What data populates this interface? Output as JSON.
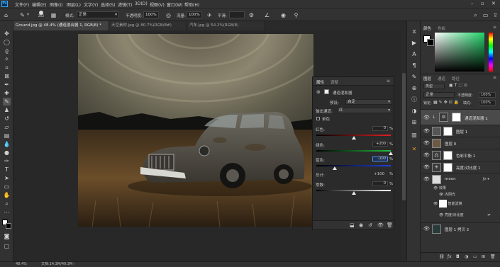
{
  "app": {
    "logo": "Ps"
  },
  "menu": [
    "文件(F)",
    "编辑(E)",
    "图像(I)",
    "图层(L)",
    "文字(Y)",
    "选择(S)",
    "滤镜(T)",
    "3D(D)",
    "视图(V)",
    "窗口(W)",
    "帮助(H)"
  ],
  "options": {
    "brush_size": "202",
    "mode_label": "模式:",
    "mode_value": "正常",
    "opacity_label": "不透明度:",
    "opacity_value": "100%",
    "flow_label": "流量:",
    "flow_value": "100%",
    "smooth_label": "平滑:"
  },
  "tabs": [
    {
      "label": "Ground.jpg @ 48.4% (通道混合器 1, RGB/8) *",
      "active": true
    },
    {
      "label": "天空素材.jpg @ 80.7%(RGB/8#)",
      "active": false
    },
    {
      "label": "汽车.jpg @ 54.2%(RGB/8)",
      "active": false
    }
  ],
  "properties": {
    "tab1": "属性",
    "tab2": "调整",
    "adj_name": "通道混和器",
    "preset_label": "预设:",
    "preset_value": "自定",
    "output_label": "输出通道:",
    "output_value": "红",
    "mono_label": "单色",
    "red_label": "红色:",
    "red_value": "0",
    "red_pct": "%",
    "red_level": 0.5,
    "green_label": "绿色:",
    "green_value": "+200",
    "green_pct": "%",
    "green_level": 1.0,
    "blue_label": "蓝色:",
    "blue_value": "-100",
    "blue_pct": "%",
    "blue_level": 0.25,
    "total_label": "总计:",
    "total_value": "+100",
    "total_pct": "%",
    "const_label": "常数:",
    "const_value": "0",
    "const_pct": "%",
    "const_level": 0.5
  },
  "color_panel": {
    "tab1": "颜色",
    "tab2": "色板"
  },
  "layers_panel": {
    "tabs": [
      "图层",
      "通道",
      "路径"
    ],
    "kind": "类型",
    "blend": "正常",
    "opacity_label": "不透明度:",
    "opacity_value": "100%",
    "lock_label": "锁定:",
    "fill_label": "填充:",
    "fill_value": "100%",
    "layers": [
      {
        "name": "通道混和器 1",
        "selected": true
      },
      {
        "name": "图层 1",
        "selected": false
      },
      {
        "name": "图层 0",
        "selected": false
      },
      {
        "name": "色彩平衡 1",
        "selected": false
      },
      {
        "name": "亮度/对比度 1",
        "selected": false
      },
      {
        "name": "moon",
        "selected": false
      },
      {
        "name": "效果",
        "selected": false
      },
      {
        "name": "内阴光",
        "selected": false
      },
      {
        "name": "智能滤镜",
        "selected": false
      },
      {
        "name": "亮度/对比度",
        "selected": false
      },
      {
        "name": "图层 1 拷贝 2",
        "selected": false
      }
    ]
  },
  "status": {
    "zoom": "48.4%",
    "doc": "文档:14.3M/49.3M"
  },
  "colors": {
    "accent": "#31a8ff",
    "bg": "#282828",
    "panel": "#323232"
  }
}
